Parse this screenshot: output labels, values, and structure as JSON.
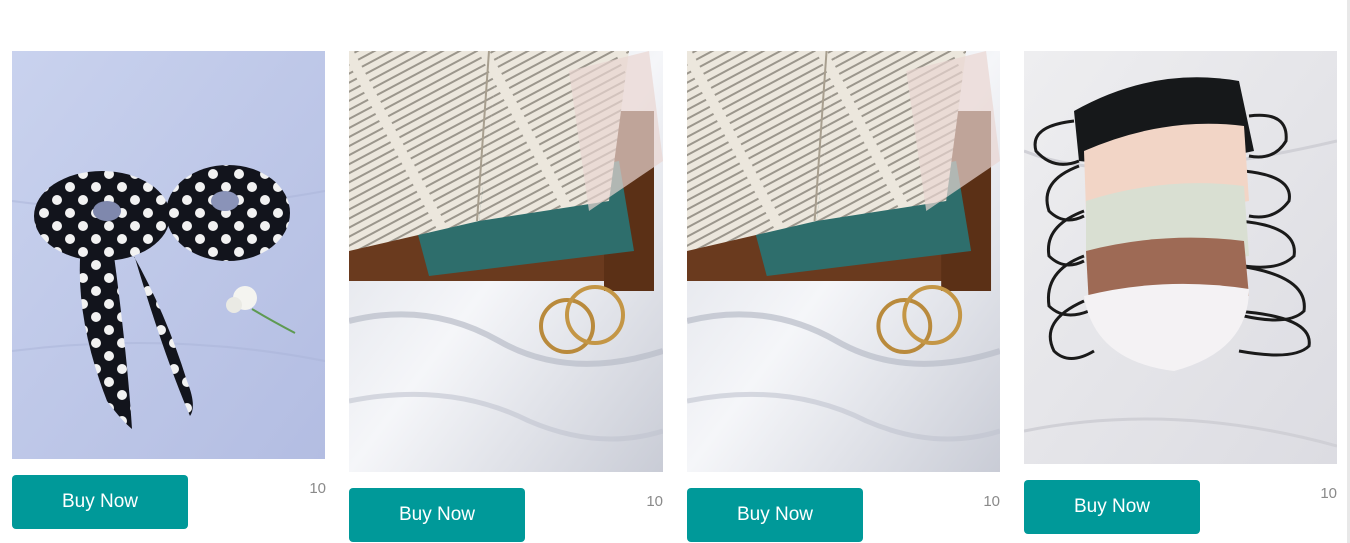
{
  "products": [
    {
      "name": "polka-dot-scrunchie-set",
      "image_icon": "polka-dot-scrunchie-image",
      "button_label": "Buy Now",
      "count": "10"
    },
    {
      "name": "book-and-hoop-earrings",
      "image_icon": "book-earrings-image",
      "button_label": "Buy Now",
      "count": "10"
    },
    {
      "name": "book-and-hoop-earrings-2",
      "image_icon": "book-earrings-image",
      "button_label": "Buy Now",
      "count": "10"
    },
    {
      "name": "satin-face-masks",
      "image_icon": "satin-masks-image",
      "button_label": "Buy Now",
      "count": "10"
    }
  ],
  "colors": {
    "button": "#009999",
    "button_text": "#ffffff",
    "count_text": "#8a8a8a"
  }
}
